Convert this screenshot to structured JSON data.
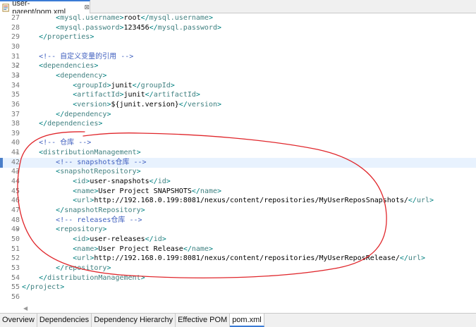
{
  "editor_tab": {
    "label": "user-parent/pom.xml",
    "close_glyph": "⊠"
  },
  "code_lines": [
    {
      "no": "27",
      "seg": [
        [
          "b",
          "        <"
        ],
        [
          "t",
          "mysql.username"
        ],
        [
          "b",
          ">"
        ],
        [
          "x",
          "root"
        ],
        [
          "b",
          "</"
        ],
        [
          "t",
          "mysql.username"
        ],
        [
          "b",
          ">"
        ]
      ]
    },
    {
      "no": "28",
      "seg": [
        [
          "b",
          "        <"
        ],
        [
          "t",
          "mysql.password"
        ],
        [
          "b",
          ">"
        ],
        [
          "x",
          "123456"
        ],
        [
          "b",
          "</"
        ],
        [
          "t",
          "mysql.password"
        ],
        [
          "b",
          ">"
        ]
      ]
    },
    {
      "no": "29",
      "seg": [
        [
          "b",
          "    </"
        ],
        [
          "t",
          "properties"
        ],
        [
          "b",
          ">"
        ]
      ]
    },
    {
      "no": "30",
      "seg": []
    },
    {
      "no": "31",
      "seg": [
        [
          "c",
          "    <!-- 自定义变量的引用 -->"
        ]
      ]
    },
    {
      "no": "32",
      "fold": true,
      "seg": [
        [
          "b",
          "    <"
        ],
        [
          "t",
          "dependencies"
        ],
        [
          "b",
          ">"
        ]
      ]
    },
    {
      "no": "33",
      "fold": true,
      "seg": [
        [
          "b",
          "        <"
        ],
        [
          "t",
          "dependency"
        ],
        [
          "b",
          ">"
        ]
      ]
    },
    {
      "no": "34",
      "seg": [
        [
          "b",
          "            <"
        ],
        [
          "t",
          "groupId"
        ],
        [
          "b",
          ">"
        ],
        [
          "x",
          "junit"
        ],
        [
          "b",
          "</"
        ],
        [
          "t",
          "groupId"
        ],
        [
          "b",
          ">"
        ]
      ]
    },
    {
      "no": "35",
      "seg": [
        [
          "b",
          "            <"
        ],
        [
          "t",
          "artifactId"
        ],
        [
          "b",
          ">"
        ],
        [
          "x",
          "junit"
        ],
        [
          "b",
          "</"
        ],
        [
          "t",
          "artifactId"
        ],
        [
          "b",
          ">"
        ]
      ]
    },
    {
      "no": "36",
      "seg": [
        [
          "b",
          "            <"
        ],
        [
          "t",
          "version"
        ],
        [
          "b",
          ">"
        ],
        [
          "x",
          "${junit.version}"
        ],
        [
          "b",
          "</"
        ],
        [
          "t",
          "version"
        ],
        [
          "b",
          ">"
        ]
      ]
    },
    {
      "no": "37",
      "seg": [
        [
          "b",
          "        </"
        ],
        [
          "t",
          "dependency"
        ],
        [
          "b",
          ">"
        ]
      ]
    },
    {
      "no": "38",
      "seg": [
        [
          "b",
          "    </"
        ],
        [
          "t",
          "dependencies"
        ],
        [
          "b",
          ">"
        ]
      ]
    },
    {
      "no": "39",
      "seg": []
    },
    {
      "no": "40",
      "seg": [
        [
          "c",
          "    <!-- 仓库 -->"
        ]
      ]
    },
    {
      "no": "41",
      "fold": true,
      "seg": [
        [
          "b",
          "    <"
        ],
        [
          "t",
          "distributionManagement"
        ],
        [
          "b",
          ">"
        ]
      ]
    },
    {
      "no": "42",
      "current": true,
      "bookmark": true,
      "seg": [
        [
          "c",
          "        <!-- snapshots仓库 -->"
        ]
      ]
    },
    {
      "no": "43",
      "fold": true,
      "seg": [
        [
          "b",
          "        <"
        ],
        [
          "t",
          "snapshotRepository"
        ],
        [
          "b",
          ">"
        ]
      ]
    },
    {
      "no": "44",
      "seg": [
        [
          "b",
          "            <"
        ],
        [
          "t",
          "id"
        ],
        [
          "b",
          ">"
        ],
        [
          "x",
          "user-snapshots"
        ],
        [
          "b",
          "</"
        ],
        [
          "t",
          "id"
        ],
        [
          "b",
          ">"
        ]
      ]
    },
    {
      "no": "45",
      "seg": [
        [
          "b",
          "            <"
        ],
        [
          "t",
          "name"
        ],
        [
          "b",
          ">"
        ],
        [
          "x",
          "User Project SNAPSHOTS"
        ],
        [
          "b",
          "</"
        ],
        [
          "t",
          "name"
        ],
        [
          "b",
          ">"
        ]
      ]
    },
    {
      "no": "46",
      "seg": [
        [
          "b",
          "            <"
        ],
        [
          "t",
          "url"
        ],
        [
          "b",
          ">"
        ],
        [
          "x",
          "http://192.168.0.199:8081/nexus/content/repositories/MyUserReposSnapshots/"
        ],
        [
          "b",
          "</"
        ],
        [
          "t",
          "url"
        ],
        [
          "b",
          ">"
        ]
      ]
    },
    {
      "no": "47",
      "seg": [
        [
          "b",
          "        </"
        ],
        [
          "t",
          "snapshotRepository"
        ],
        [
          "b",
          ">"
        ]
      ]
    },
    {
      "no": "48",
      "seg": [
        [
          "c",
          "        <!-- releases仓库 -->"
        ]
      ]
    },
    {
      "no": "49",
      "fold": true,
      "seg": [
        [
          "b",
          "        <"
        ],
        [
          "t",
          "repository"
        ],
        [
          "b",
          ">"
        ]
      ]
    },
    {
      "no": "50",
      "seg": [
        [
          "b",
          "            <"
        ],
        [
          "t",
          "id"
        ],
        [
          "b",
          ">"
        ],
        [
          "x",
          "user-releases"
        ],
        [
          "b",
          "</"
        ],
        [
          "t",
          "id"
        ],
        [
          "b",
          ">"
        ]
      ]
    },
    {
      "no": "51",
      "seg": [
        [
          "b",
          "            <"
        ],
        [
          "t",
          "name"
        ],
        [
          "b",
          ">"
        ],
        [
          "x",
          "User Project Release"
        ],
        [
          "b",
          "</"
        ],
        [
          "t",
          "name"
        ],
        [
          "b",
          ">"
        ]
      ]
    },
    {
      "no": "52",
      "seg": [
        [
          "b",
          "            <"
        ],
        [
          "t",
          "url"
        ],
        [
          "b",
          ">"
        ],
        [
          "x",
          "http://192.168.0.199:8081/nexus/content/repositories/MyUserReposRelease/"
        ],
        [
          "b",
          "</"
        ],
        [
          "t",
          "url"
        ],
        [
          "b",
          ">"
        ]
      ]
    },
    {
      "no": "53",
      "seg": [
        [
          "b",
          "        </"
        ],
        [
          "t",
          "repository"
        ],
        [
          "b",
          ">"
        ]
      ]
    },
    {
      "no": "54",
      "seg": [
        [
          "b",
          "    </"
        ],
        [
          "t",
          "distributionManagement"
        ],
        [
          "b",
          ">"
        ]
      ]
    },
    {
      "no": "55",
      "seg": [
        [
          "b",
          "</"
        ],
        [
          "t",
          "project"
        ],
        [
          "b",
          ">"
        ]
      ]
    },
    {
      "no": "56",
      "seg": []
    }
  ],
  "bottom_tabs": [
    {
      "label": "Overview",
      "active": false
    },
    {
      "label": "Dependencies",
      "active": false
    },
    {
      "label": "Dependency Hierarchy",
      "active": false
    },
    {
      "label": "Effective POM",
      "active": false
    },
    {
      "label": "pom.xml",
      "active": true
    }
  ],
  "colors": {
    "accent": "#3a7bd5",
    "annotation_stroke": "#e0262b",
    "current_line": "#e8f2fe"
  }
}
